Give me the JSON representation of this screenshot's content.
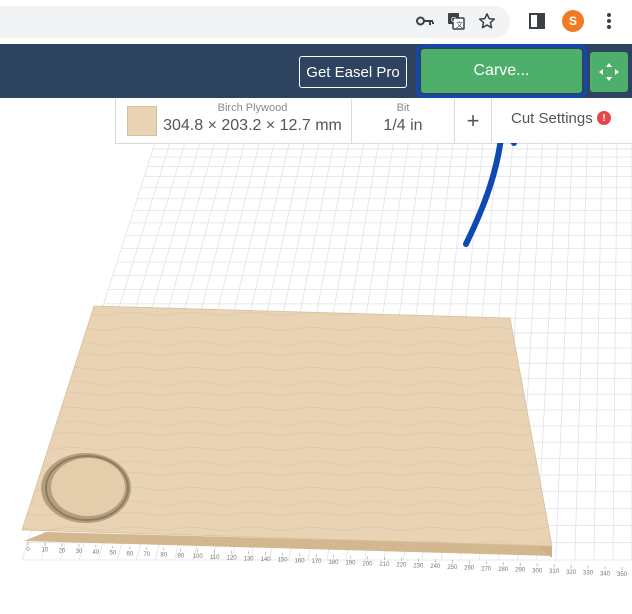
{
  "browser": {
    "icons": [
      "key-icon",
      "translate-icon",
      "star-icon",
      "sidebar-icon",
      "menu-icon"
    ],
    "profile_initial": "S"
  },
  "header": {
    "pro_label": "Get Easel Pro",
    "carve_label": "Carve...",
    "colors": {
      "header": "#2d4360",
      "carve": "#4daf6a",
      "highlight": "#0f49b5"
    }
  },
  "toolbar": {
    "material_name": "Birch Plywood",
    "material_dims": "304.8 × 203.2 × 12.7 mm",
    "bit_label": "Bit",
    "bit_value": "1/4 in",
    "add_label": "+",
    "cut_settings_label": "Cut Settings",
    "warning_glyph": "!"
  },
  "canvas": {
    "ruler_labels": [
      "0",
      "10",
      "20",
      "30",
      "40",
      "50",
      "60",
      "70",
      "80",
      "90",
      "100",
      "110",
      "120",
      "130",
      "140",
      "150",
      "160",
      "170",
      "180",
      "190",
      "200",
      "210",
      "220",
      "230",
      "240",
      "250",
      "260",
      "270",
      "280",
      "290",
      "300",
      "310",
      "320",
      "330",
      "340",
      "350"
    ],
    "material_color": "#e8d3b4"
  }
}
